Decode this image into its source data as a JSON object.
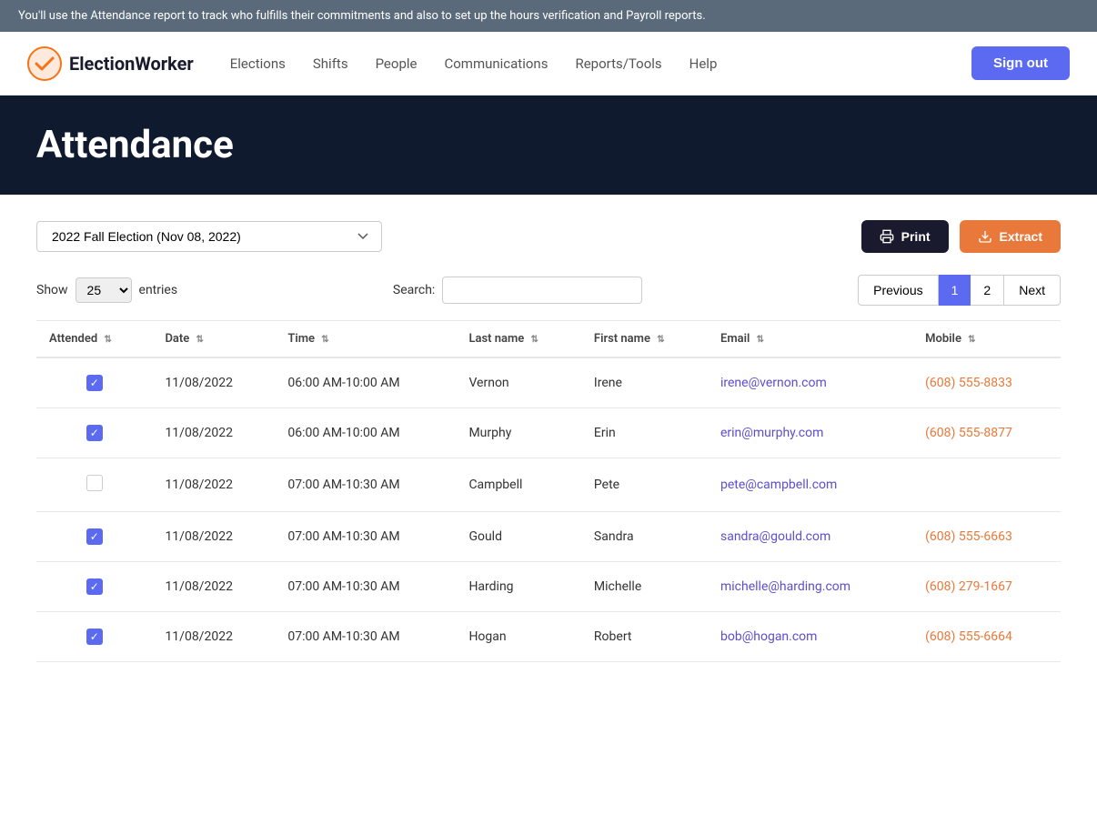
{
  "banner": {
    "text": "You'll use the Attendance report to track who fulfills their commitments and also to set up the hours verification and Payroll reports."
  },
  "nav": {
    "logo_text": "ElectionWorker",
    "links": [
      {
        "label": "Elections",
        "href": "#"
      },
      {
        "label": "Shifts",
        "href": "#"
      },
      {
        "label": "People",
        "href": "#"
      },
      {
        "label": "Communications",
        "href": "#"
      },
      {
        "label": "Reports/Tools",
        "href": "#"
      },
      {
        "label": "Help",
        "href": "#"
      }
    ],
    "sign_out": "Sign out"
  },
  "page": {
    "title": "Attendance"
  },
  "filters": {
    "election_label": "2022 Fall Election (Nov 08, 2022)",
    "print_label": "Print",
    "extract_label": "Extract"
  },
  "table_controls": {
    "show_label": "Show",
    "entries_value": "25",
    "entries_label": "entries",
    "search_label": "Search:",
    "search_placeholder": "",
    "prev_label": "Previous",
    "next_label": "Next",
    "page1_label": "1",
    "page2_label": "2"
  },
  "columns": [
    {
      "label": "Attended",
      "key": "attended"
    },
    {
      "label": "Date",
      "key": "date"
    },
    {
      "label": "Time",
      "key": "time"
    },
    {
      "label": "Last name",
      "key": "last_name"
    },
    {
      "label": "First name",
      "key": "first_name"
    },
    {
      "label": "Email",
      "key": "email"
    },
    {
      "label": "Mobile",
      "key": "mobile"
    }
  ],
  "rows": [
    {
      "attended": true,
      "date": "11/08/2022",
      "time": "06:00 AM-10:00 AM",
      "last_name": "Vernon",
      "first_name": "Irene",
      "email": "irene@vernon.com",
      "mobile": "(608) 555-8833"
    },
    {
      "attended": true,
      "date": "11/08/2022",
      "time": "06:00 AM-10:00 AM",
      "last_name": "Murphy",
      "first_name": "Erin",
      "email": "erin@murphy.com",
      "mobile": "(608) 555-8877"
    },
    {
      "attended": false,
      "date": "11/08/2022",
      "time": "07:00 AM-10:30 AM",
      "last_name": "Campbell",
      "first_name": "Pete",
      "email": "pete@campbell.com",
      "mobile": ""
    },
    {
      "attended": true,
      "date": "11/08/2022",
      "time": "07:00 AM-10:30 AM",
      "last_name": "Gould",
      "first_name": "Sandra",
      "email": "sandra@gould.com",
      "mobile": "(608) 555-6663"
    },
    {
      "attended": true,
      "date": "11/08/2022",
      "time": "07:00 AM-10:30 AM",
      "last_name": "Harding",
      "first_name": "Michelle",
      "email": "michelle@harding.com",
      "mobile": "(608) 279-1667"
    },
    {
      "attended": true,
      "date": "11/08/2022",
      "time": "07:00 AM-10:30 AM",
      "last_name": "Hogan",
      "first_name": "Robert",
      "email": "bob@hogan.com",
      "mobile": "(608) 555-6664"
    }
  ]
}
